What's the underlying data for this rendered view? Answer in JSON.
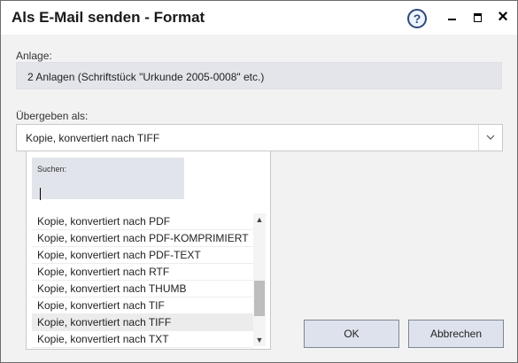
{
  "window": {
    "title": "Als E-Mail senden - Format"
  },
  "anlage": {
    "label": "Anlage:",
    "value": "2 Anlagen (Schriftstück \"Urkunde 2005-0008\" etc.)"
  },
  "uebergeben": {
    "label": "Übergeben als:",
    "selected": "Kopie, konvertiert nach TIFF"
  },
  "dropdown": {
    "search_label": "Suchen:",
    "search_value": "",
    "items": [
      "Kopie, konvertiert nach PDF",
      "Kopie, konvertiert nach PDF-KOMPRIMIERT",
      "Kopie, konvertiert nach PDF-TEXT",
      "Kopie, konvertiert nach RTF",
      "Kopie, konvertiert nach THUMB",
      "Kopie, konvertiert nach TIF",
      "Kopie, konvertiert nach TIFF",
      "Kopie, konvertiert nach TXT"
    ],
    "selected_index": 6,
    "scroll_position": 0.75
  },
  "buttons": {
    "ok": "OK",
    "cancel": "Abbrechen"
  },
  "icons": {
    "help": "help-icon",
    "minimize": "minimize-icon",
    "maximize": "maximize-icon",
    "close": "close-icon",
    "dropdown": "chevron-down-icon"
  },
  "colors": {
    "button_bg": "#dde2ec",
    "field_bg": "#e3e5ea",
    "help_icon": "#2b4a7a"
  }
}
